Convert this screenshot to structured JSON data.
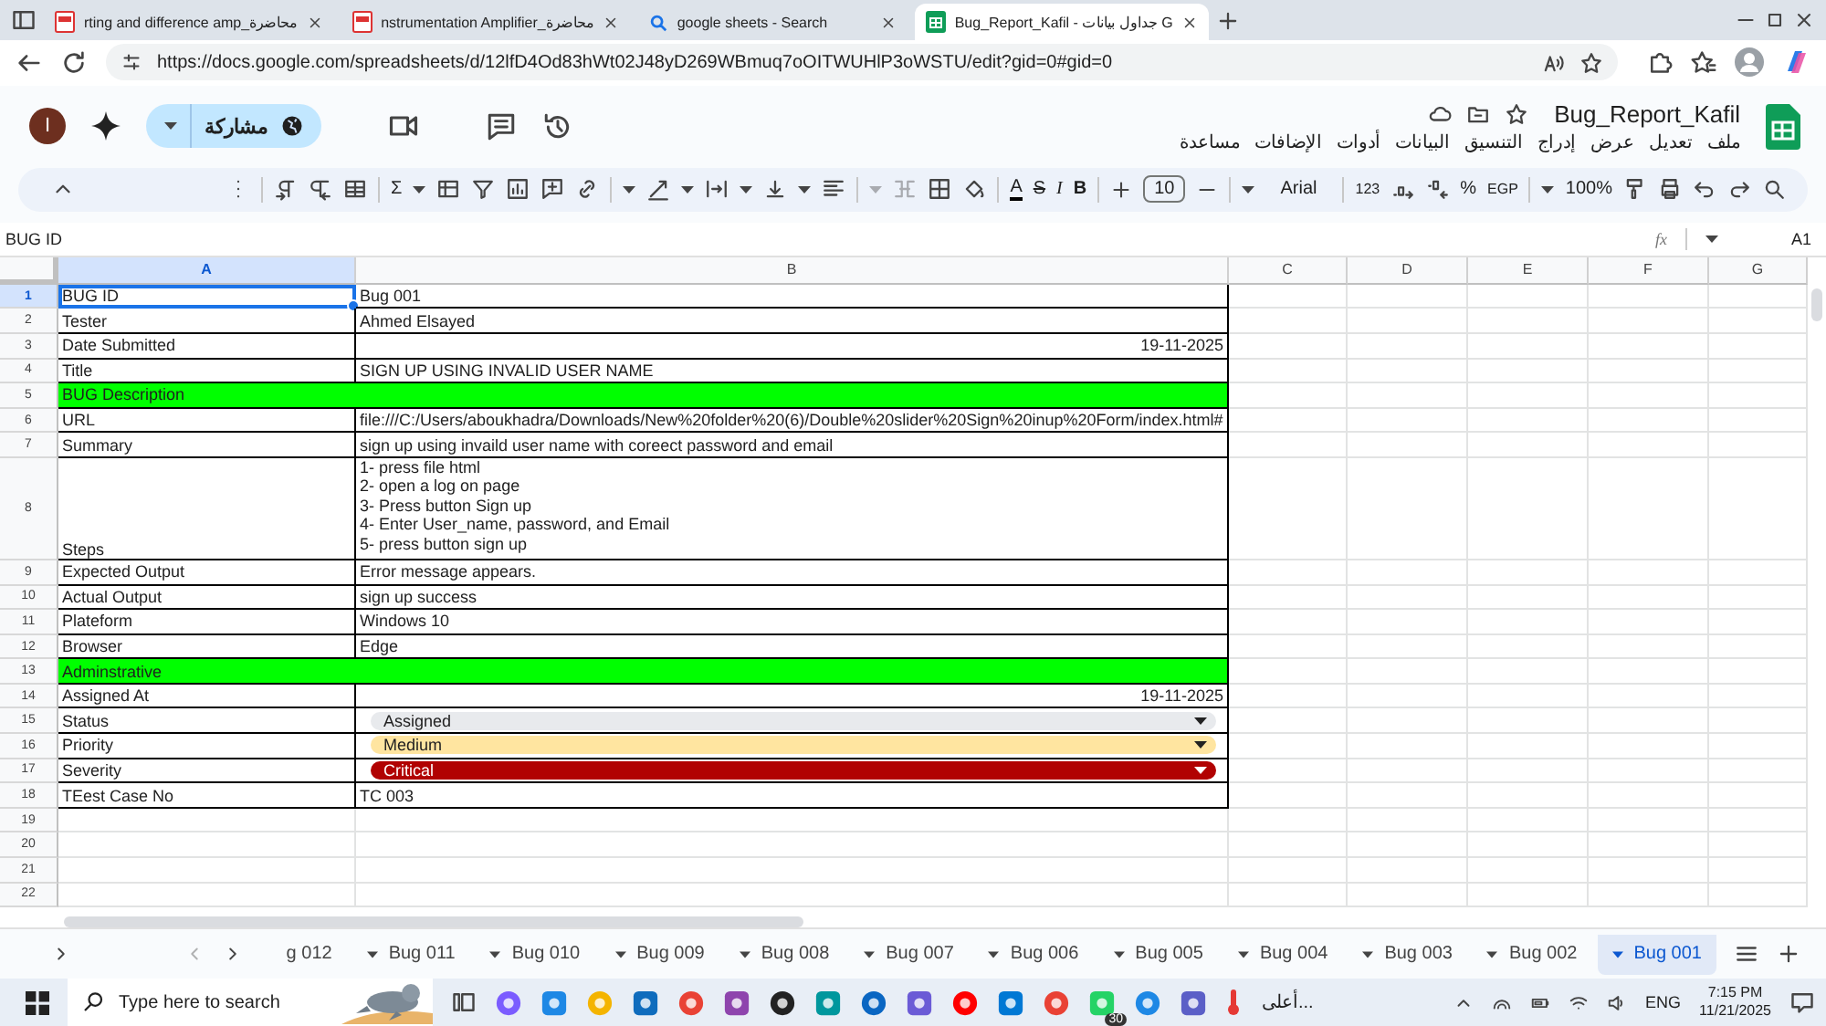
{
  "browser_tabs": [
    {
      "title": "rting and difference amp_محاضرة",
      "kind": "pdf",
      "selected": false
    },
    {
      "title": "nstrumentation Amplifier_محاضرة",
      "kind": "pdf",
      "selected": false
    },
    {
      "title": "google sheets - Search",
      "kind": "search",
      "selected": false
    },
    {
      "title": "Bug_Report_Kafil - جداول بيانات G",
      "kind": "sheets",
      "selected": true
    }
  ],
  "address": "https://docs.google.com/spreadsheets/d/12lfD4Od83hWt02J48yD269WBmuq7oOITWUHlP3oWSTU/edit?gid=0#gid=0",
  "document": {
    "title": "Bug_Report_Kafil",
    "share_label": "مشاركة",
    "avatar_letter": "I"
  },
  "menu": [
    "ملف",
    "تعديل",
    "عرض",
    "إدراج",
    "التنسيق",
    "البيانات",
    "أدوات",
    "الإضافات",
    "مساعدة"
  ],
  "toolbar": {
    "sum": "Σ",
    "text_color": "A",
    "strikethrough": "S",
    "italic": "I",
    "bold": "B",
    "font_size": "10",
    "font": "Arial",
    "number_format": "123",
    "percent": "%",
    "currency": "EGP",
    "zoom": "100%"
  },
  "formula_bar": {
    "content": "BUG ID",
    "function_label": "fx",
    "cell_ref": "A1"
  },
  "columns": [
    {
      "label": "A",
      "selected": true
    },
    {
      "label": "B",
      "selected": false
    },
    {
      "label": "C",
      "selected": false
    },
    {
      "label": "D",
      "selected": false
    },
    {
      "label": "E",
      "selected": false
    },
    {
      "label": "F",
      "selected": false
    },
    {
      "label": "G",
      "selected": false
    }
  ],
  "rows": [
    {
      "number": "1",
      "kind": "field",
      "label": "BUG ID",
      "value": "Bug 001",
      "selected": true
    },
    {
      "number": "2",
      "kind": "field",
      "label": "Tester",
      "value": "Ahmed Elsayed",
      "selected": false
    },
    {
      "number": "3",
      "kind": "date",
      "label": "Date Submitted",
      "value": "19-11-2025",
      "selected": false
    },
    {
      "number": "4",
      "kind": "field",
      "label": "Title",
      "value": "SIGN UP USING INVALID USER NAME",
      "selected": false
    },
    {
      "number": "5",
      "kind": "section",
      "label": "BUG Description",
      "color": "#00ff00",
      "selected": false
    },
    {
      "number": "6",
      "kind": "field",
      "label": "URL",
      "value": "file:///C:/Users/aboukhadra/Downloads/New%20folder%20(6)/Double%20slider%20Sign%20inup%20Form/index.html#",
      "selected": false
    },
    {
      "number": "7",
      "kind": "field",
      "label": "Summary",
      "value": "sign up using invaild user name with coreect password and email",
      "selected": false
    },
    {
      "number": "8",
      "kind": "multiline",
      "label": "Steps",
      "lines": [
        "1- press file html",
        "2- open a log on page",
        "3- Press button Sign up",
        "4- Enter User_name, password, and Email",
        "5- press button sign up"
      ],
      "selected": false
    },
    {
      "number": "9",
      "kind": "field",
      "label": "Expected Output",
      "value": "Error message appears.",
      "selected": false
    },
    {
      "number": "10",
      "kind": "field",
      "label": "Actual Output",
      "value": "sign up success",
      "selected": false
    },
    {
      "number": "11",
      "kind": "field",
      "label": "Plateform",
      "value": "Windows 10",
      "selected": false
    },
    {
      "number": "12",
      "kind": "field",
      "label": "Browser",
      "value": "Edge",
      "selected": false
    },
    {
      "number": "13",
      "kind": "section",
      "label": "Adminstrative",
      "color": "#00ff00",
      "selected": false
    },
    {
      "number": "14",
      "kind": "date",
      "label": "Assigned At",
      "value": "19-11-2025",
      "selected": false
    },
    {
      "number": "15",
      "kind": "chip",
      "label": "Status",
      "value": "Assigned",
      "color": "#e8eaed",
      "selected": false
    },
    {
      "number": "16",
      "kind": "chip",
      "label": "Priority",
      "value": "Medium",
      "color": "#ffe5a0",
      "selected": false
    },
    {
      "number": "17",
      "kind": "chip",
      "label": "Severity",
      "value": "Critical",
      "color": "#b10202",
      "selected": false
    },
    {
      "number": "18",
      "kind": "field",
      "label": "TEest Case No",
      "value": "TC 003",
      "selected": false
    },
    {
      "number": "19",
      "kind": "empty",
      "selected": false
    },
    {
      "number": "20",
      "kind": "empty",
      "selected": false
    },
    {
      "number": "21",
      "kind": "empty",
      "selected": false
    },
    {
      "number": "22",
      "kind": "empty",
      "selected": false
    }
  ],
  "sheet_tabs": [
    {
      "label": "g 012",
      "selected": false
    },
    {
      "label": "Bug 011",
      "selected": false
    },
    {
      "label": "Bug 010",
      "selected": false
    },
    {
      "label": "Bug 009",
      "selected": false
    },
    {
      "label": "Bug 008",
      "selected": false
    },
    {
      "label": "Bug 007",
      "selected": false
    },
    {
      "label": "Bug 006",
      "selected": false
    },
    {
      "label": "Bug 005",
      "selected": false
    },
    {
      "label": "Bug 004",
      "selected": false
    },
    {
      "label": "Bug 003",
      "selected": false
    },
    {
      "label": "Bug 002",
      "selected": false
    },
    {
      "label": "Bug 001",
      "selected": true
    }
  ],
  "taskbar": {
    "search_placeholder": "Type here to search",
    "weather_text": "أعلى...",
    "badge": "30",
    "language": "ENG",
    "time": "7:15 PM",
    "date": "11/21/2025"
  }
}
